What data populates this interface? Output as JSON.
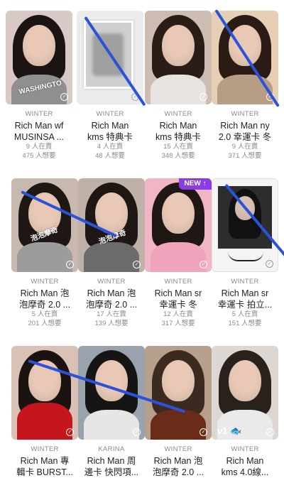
{
  "cards": [
    {
      "artist": "WINTER",
      "title_line1": "Rich Man wf",
      "title_line2": "MUSINSA ...",
      "sellers": "9 人在賣",
      "wants": "475 人想要",
      "bg": "#d8c9c6",
      "hair": "#1c1412",
      "body": "#8f8f8f",
      "tag": "WASHINGTO"
    },
    {
      "artist": "WINTER",
      "title_line1": "Rich Man",
      "title_line2": "kms 特典卡",
      "sellers": "4 人在賣",
      "wants": "48 人想要",
      "bg": "#ececec",
      "hair": "#9a9a9a",
      "body": "#c8c8c8",
      "tag": ""
    },
    {
      "artist": "WINTER",
      "title_line1": "Rich Man",
      "title_line2": "kms 特典卡",
      "sellers": "15 人在賣",
      "wants": "348 人想要",
      "bg": "#cdbcb2",
      "hair": "#2a1c16",
      "body": "#e8e3e0",
      "tag": ""
    },
    {
      "artist": "WINTER",
      "title_line1": "Rich Man ny",
      "title_line2": "2.0 幸運卡 冬",
      "sellers": "9 人在賣",
      "wants": "371 人想要",
      "bg": "#e7cfb6",
      "hair": "#2a1c14",
      "body": "#b79c86",
      "tag": ""
    },
    {
      "artist": "WINTER",
      "title_line1": "Rich Man 泡",
      "title_line2": "泡摩奇 2.0 ...",
      "sellers": "5 人在賣",
      "wants": "201 人想要",
      "bg": "#c9b8ae",
      "hair": "#1f1713",
      "body": "#9c9c9c",
      "tag": "泡泡摩奇"
    },
    {
      "artist": "WINTER",
      "title_line1": "Rich Man 泡",
      "title_line2": "泡摩奇 2.0 ...",
      "sellers": "17 人在賣",
      "wants": "139 人想要",
      "bg": "#bfb0a8",
      "hair": "#1f1713",
      "body": "#6b6b6b",
      "tag": "泡泡摩奇"
    },
    {
      "artist": "WINTER",
      "title_line1": "Rich Man sr",
      "title_line2": "幸運卡 冬",
      "sellers": "12 人在賣",
      "wants": "317 人想要",
      "bg": "#f1b6c6",
      "hair": "#1f1713",
      "body": "#f0a4bb",
      "tag": "",
      "new_badge": "NEW ↑"
    },
    {
      "artist": "WINTER",
      "title_line1": "Rich Man sr",
      "title_line2": "幸運卡 拍立...",
      "sellers": "5 人在賣",
      "wants": "151 人想要",
      "bg": "#f4f4f4",
      "hair": "#111111",
      "body": "#2b2b2b",
      "tag": ""
    },
    {
      "artist": "WINTER",
      "title_line1": "Rich Man 專",
      "title_line2": "輯卡 BURST...",
      "sellers": "",
      "wants": "",
      "bg": "#d9c2b5",
      "hair": "#1b1310",
      "body": "#c4161c",
      "tag": ""
    },
    {
      "artist": "KARINA",
      "title_line1": "Rich Man 周",
      "title_line2": "邊卡 快閃項...",
      "sellers": "",
      "wants": "",
      "bg": "#9aa3ad",
      "hair": "#151515",
      "body": "#e6e6e6",
      "tag": ""
    },
    {
      "artist": "WINTER",
      "title_line1": "Rich Man 泡",
      "title_line2": "泡摩奇 2.0 ...",
      "sellers": "",
      "wants": "",
      "bg": "#b7a08b",
      "hair": "#3b2a1f",
      "body": "#6a2b18",
      "tag": ""
    },
    {
      "artist": "WINTER",
      "title_line1": "Rich Man",
      "title_line2": "kms 4.0線...",
      "sellers": "",
      "wants": "",
      "bg": "#dcd7d3",
      "hair": "#2a211c",
      "body": "#eaeaea",
      "tag": "",
      "v1": "v1 🐟"
    }
  ],
  "accent": "#2b53d8",
  "badge_color": "#8a3ce6"
}
